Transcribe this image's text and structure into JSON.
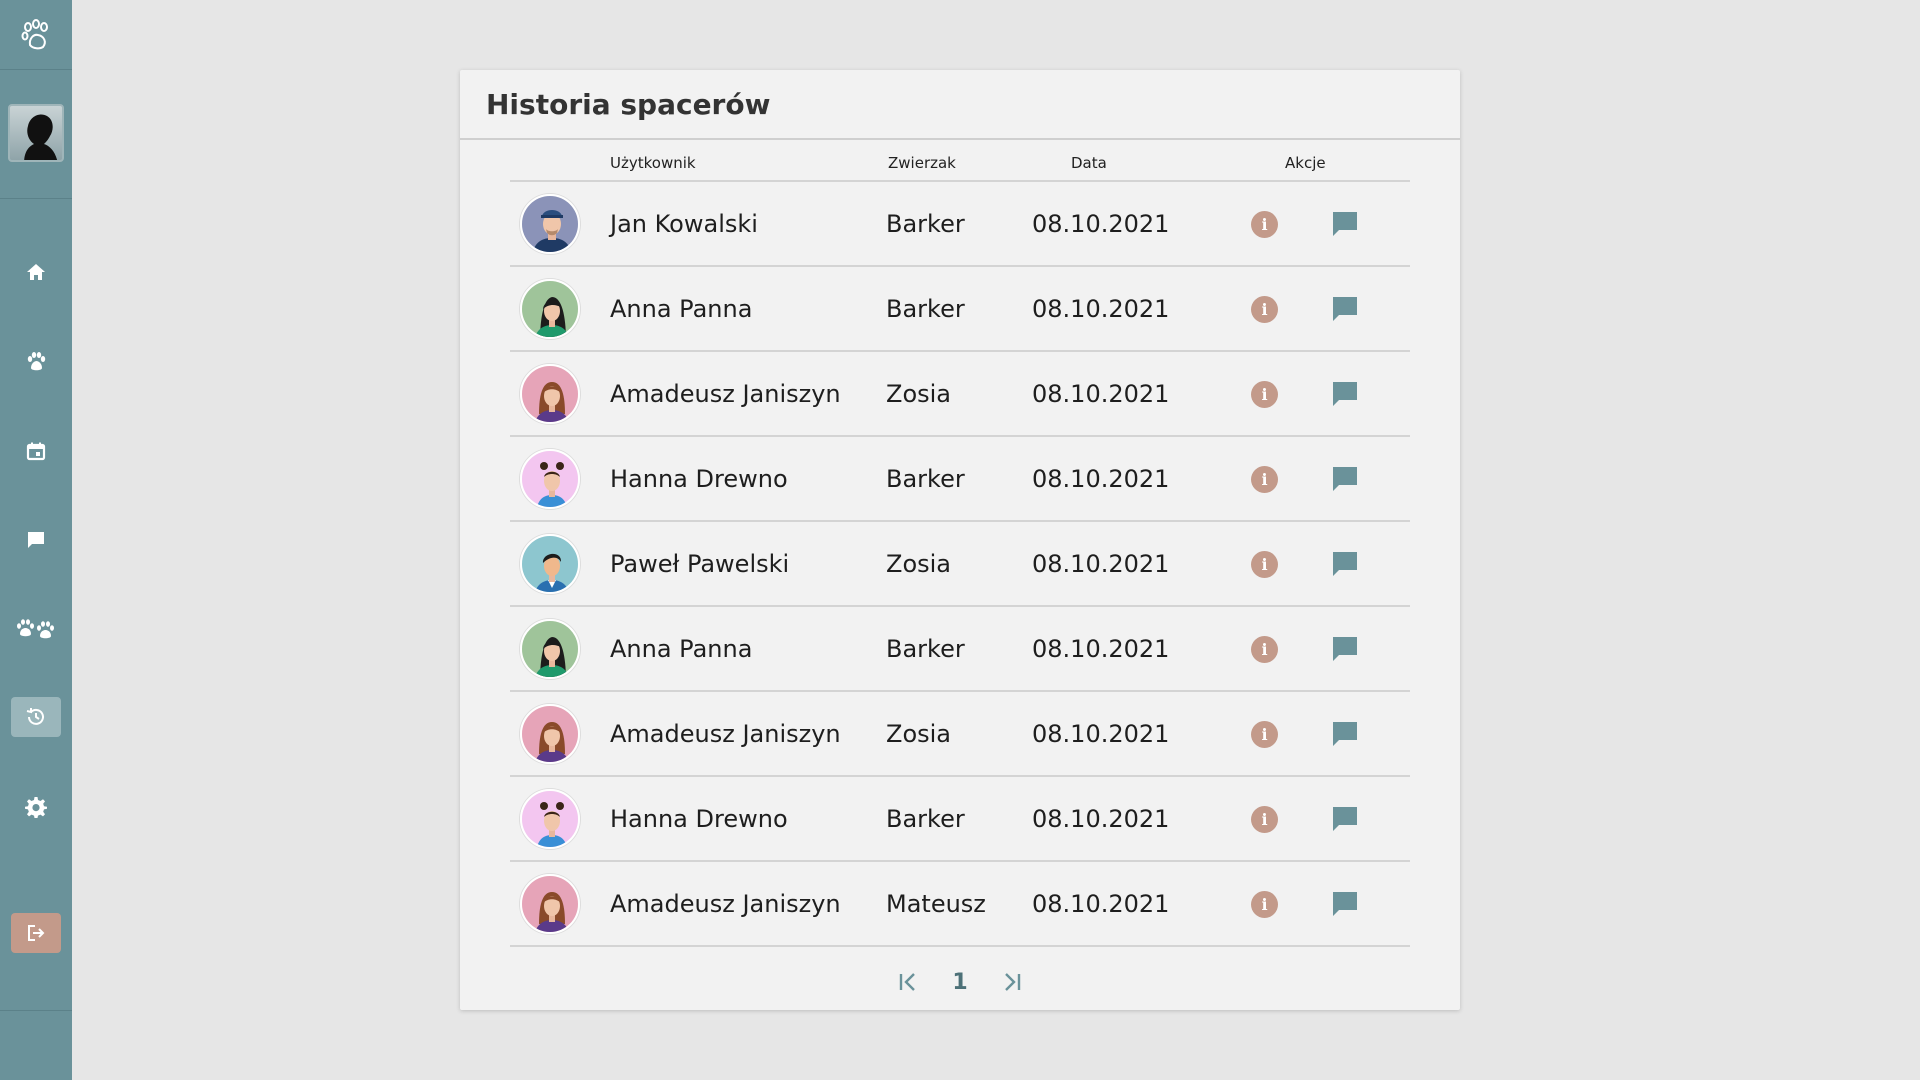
{
  "app": {
    "colors": {
      "sidebar": "#6a929a",
      "accent": "#c39a8a",
      "message_icon": "#6a929a"
    }
  },
  "sidebar": {
    "items": [
      {
        "name": "home",
        "icon": "home-icon"
      },
      {
        "name": "pets",
        "icon": "paw-icon"
      },
      {
        "name": "calendar",
        "icon": "calendar-icon"
      },
      {
        "name": "messages",
        "icon": "chat-icon"
      },
      {
        "name": "community",
        "icon": "multi-paw-icon"
      },
      {
        "name": "history",
        "icon": "history-icon",
        "active": true
      },
      {
        "name": "settings",
        "icon": "gear-icon"
      }
    ],
    "logout_icon": "logout-icon"
  },
  "card": {
    "title": "Historia spacerów",
    "columns": {
      "user": "Użytkownik",
      "pet": "Zwierzak",
      "date": "Data",
      "actions": "Akcje"
    },
    "rows": [
      {
        "user": "Jan Kowalski",
        "pet": "Barker",
        "date": "08.10.2021",
        "avatar": "man-cap"
      },
      {
        "user": "Anna Panna",
        "pet": "Barker",
        "date": "08.10.2021",
        "avatar": "woman-dark"
      },
      {
        "user": "Amadeusz Janiszyn",
        "pet": "Zosia",
        "date": "08.10.2021",
        "avatar": "woman-brown"
      },
      {
        "user": "Hanna Drewno",
        "pet": "Barker",
        "date": "08.10.2021",
        "avatar": "girl-buns"
      },
      {
        "user": "Paweł Pawelski",
        "pet": "Zosia",
        "date": "08.10.2021",
        "avatar": "man-blue"
      },
      {
        "user": "Anna Panna",
        "pet": "Barker",
        "date": "08.10.2021",
        "avatar": "woman-dark"
      },
      {
        "user": "Amadeusz Janiszyn",
        "pet": "Zosia",
        "date": "08.10.2021",
        "avatar": "woman-brown"
      },
      {
        "user": "Hanna Drewno",
        "pet": "Barker",
        "date": "08.10.2021",
        "avatar": "girl-buns"
      },
      {
        "user": "Amadeusz Janiszyn",
        "pet": "Mateusz",
        "date": "08.10.2021",
        "avatar": "woman-brown"
      }
    ],
    "info_glyph": "i"
  },
  "pagination": {
    "current_page": "1"
  }
}
